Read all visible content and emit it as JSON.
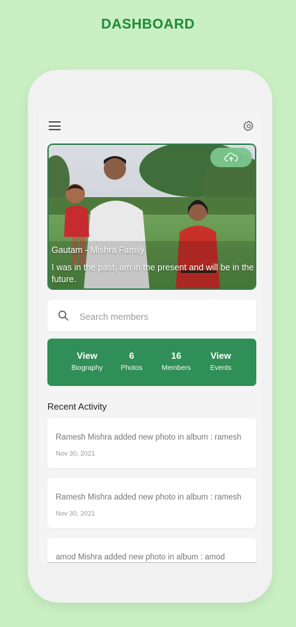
{
  "screen_title": "DASHBOARD",
  "family": {
    "name": "Gautam - Mishra Family",
    "quote": "I was in the past, am in the present and will be in the future."
  },
  "search": {
    "placeholder": "Search members"
  },
  "stats": [
    {
      "value": "View",
      "label": "Biography"
    },
    {
      "value": "6",
      "label": "Photos"
    },
    {
      "value": "16",
      "label": "Members"
    },
    {
      "value": "View",
      "label": "Events"
    }
  ],
  "recent_activity": {
    "title": "Recent Activity",
    "items": [
      {
        "text": "Ramesh Mishra added new photo in album : ramesh",
        "date": "Nov 30, 2021"
      },
      {
        "text": "Ramesh Mishra added new photo in album : ramesh",
        "date": "Nov 30, 2021"
      },
      {
        "text": "amod Mishra added new photo in album : amod",
        "date": ""
      }
    ]
  },
  "icons": {
    "menu": "hamburger-menu-icon",
    "settings": "gear-icon",
    "upload": "cloud-upload-icon",
    "search": "search-icon"
  },
  "colors": {
    "background": "#c9efc3",
    "accent": "#2f8f56",
    "title": "#1e8a3c"
  }
}
